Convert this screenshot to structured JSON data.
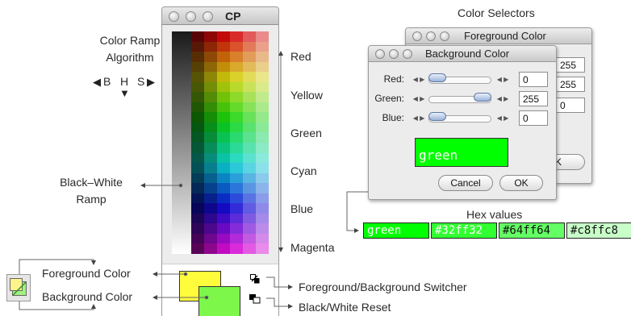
{
  "labels": {
    "color_ramp_line1": "Color Ramp",
    "color_ramp_line2": "Algorithm",
    "bhs": {
      "b": "B",
      "h": "H",
      "s": "S"
    },
    "black_white_line1": "Black–White",
    "black_white_line2": "Ramp",
    "hue_names": [
      "Red",
      "Yellow",
      "Green",
      "Cyan",
      "Blue",
      "Magenta"
    ],
    "foreground_color": "Foreground Color",
    "background_color": "Background Color",
    "switcher": "Foreground/Background Switcher",
    "reset": "Black/White Reset",
    "color_selectors": "Color Selectors",
    "hex_values": "Hex values"
  },
  "cp_window": {
    "title": "CP"
  },
  "foreground_window": {
    "title": "Foreground Color",
    "values": [
      "255",
      "255",
      "0"
    ],
    "ok_partial": "OK"
  },
  "background_window": {
    "title": "Background Color",
    "rows": [
      {
        "label": "Red:",
        "value": "0",
        "level": 0
      },
      {
        "label": "Green:",
        "value": "255",
        "level": 1
      },
      {
        "label": "Blue:",
        "value": "0",
        "level": 0
      }
    ],
    "preview_text": "green",
    "preview_color": "#00ff00",
    "cancel_label": "Cancel",
    "ok_label": "OK"
  },
  "hex_values": [
    {
      "text": "green",
      "color": "#00ff00"
    },
    {
      "text": "#32ff32",
      "color": "#32ff32"
    },
    {
      "text": "#64ff64",
      "color": "#64ff64"
    },
    {
      "text": "#c8ffc8",
      "color": "#c8ffc8"
    }
  ],
  "swatches": {
    "foreground": "#fffc3c",
    "background": "#7cf74a"
  }
}
